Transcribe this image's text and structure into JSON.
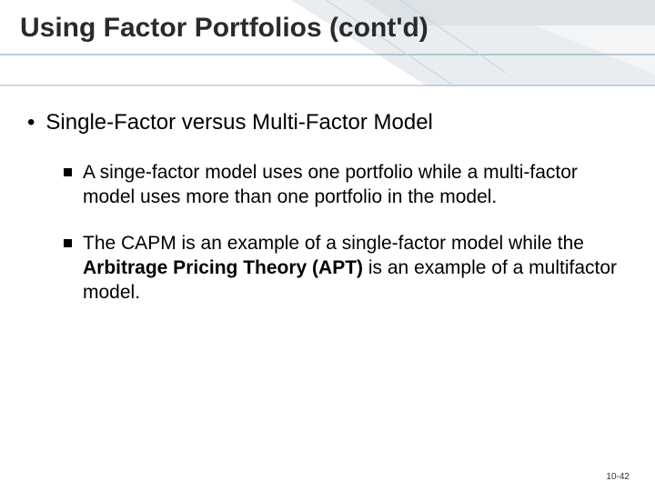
{
  "title": "Using Factor Portfolios (cont'd)",
  "main_bullet": "Single-Factor versus Multi-Factor Model",
  "sub_bullets": {
    "b1_pre": "A singe-factor model uses one portfolio while a multi-factor model uses more than one portfolio in the model.",
    "b2_pre": "The CAPM is an example of a single-factor model while the ",
    "b2_bold": "Arbitrage Pricing Theory (APT)",
    "b2_post": " is an example of a multifactor model."
  },
  "page_number": "10-42"
}
